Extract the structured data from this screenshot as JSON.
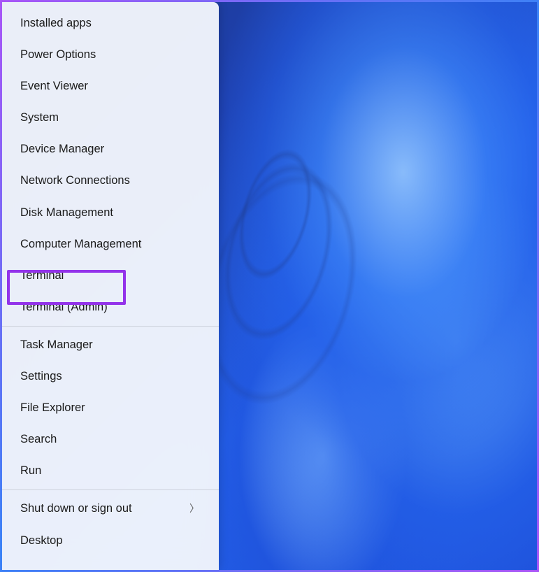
{
  "contextMenu": {
    "groups": [
      {
        "items": [
          {
            "id": "installed-apps",
            "label": "Installed apps",
            "hasSubmenu": false,
            "highlighted": false
          },
          {
            "id": "power-options",
            "label": "Power Options",
            "hasSubmenu": false,
            "highlighted": false
          },
          {
            "id": "event-viewer",
            "label": "Event Viewer",
            "hasSubmenu": false,
            "highlighted": false
          },
          {
            "id": "system",
            "label": "System",
            "hasSubmenu": false,
            "highlighted": false
          },
          {
            "id": "device-manager",
            "label": "Device Manager",
            "hasSubmenu": false,
            "highlighted": false
          },
          {
            "id": "network-connections",
            "label": "Network Connections",
            "hasSubmenu": false,
            "highlighted": false
          },
          {
            "id": "disk-management",
            "label": "Disk Management",
            "hasSubmenu": false,
            "highlighted": false
          },
          {
            "id": "computer-management",
            "label": "Computer Management",
            "hasSubmenu": false,
            "highlighted": false
          },
          {
            "id": "terminal",
            "label": "Terminal",
            "hasSubmenu": false,
            "highlighted": true
          },
          {
            "id": "terminal-admin",
            "label": "Terminal (Admin)",
            "hasSubmenu": false,
            "highlighted": false
          }
        ]
      },
      {
        "items": [
          {
            "id": "task-manager",
            "label": "Task Manager",
            "hasSubmenu": false,
            "highlighted": false
          },
          {
            "id": "settings",
            "label": "Settings",
            "hasSubmenu": false,
            "highlighted": false
          },
          {
            "id": "file-explorer",
            "label": "File Explorer",
            "hasSubmenu": false,
            "highlighted": false
          },
          {
            "id": "search",
            "label": "Search",
            "hasSubmenu": false,
            "highlighted": false
          },
          {
            "id": "run",
            "label": "Run",
            "hasSubmenu": false,
            "highlighted": false
          }
        ]
      },
      {
        "items": [
          {
            "id": "shut-down-sign-out",
            "label": "Shut down or sign out",
            "hasSubmenu": true,
            "highlighted": false
          },
          {
            "id": "desktop",
            "label": "Desktop",
            "hasSubmenu": false,
            "highlighted": false
          }
        ]
      }
    ]
  },
  "colors": {
    "highlightBorder": "#9333ea",
    "menuBackground": "rgba(242, 246, 252, 0.96)",
    "menuText": "#1a1a1a"
  }
}
